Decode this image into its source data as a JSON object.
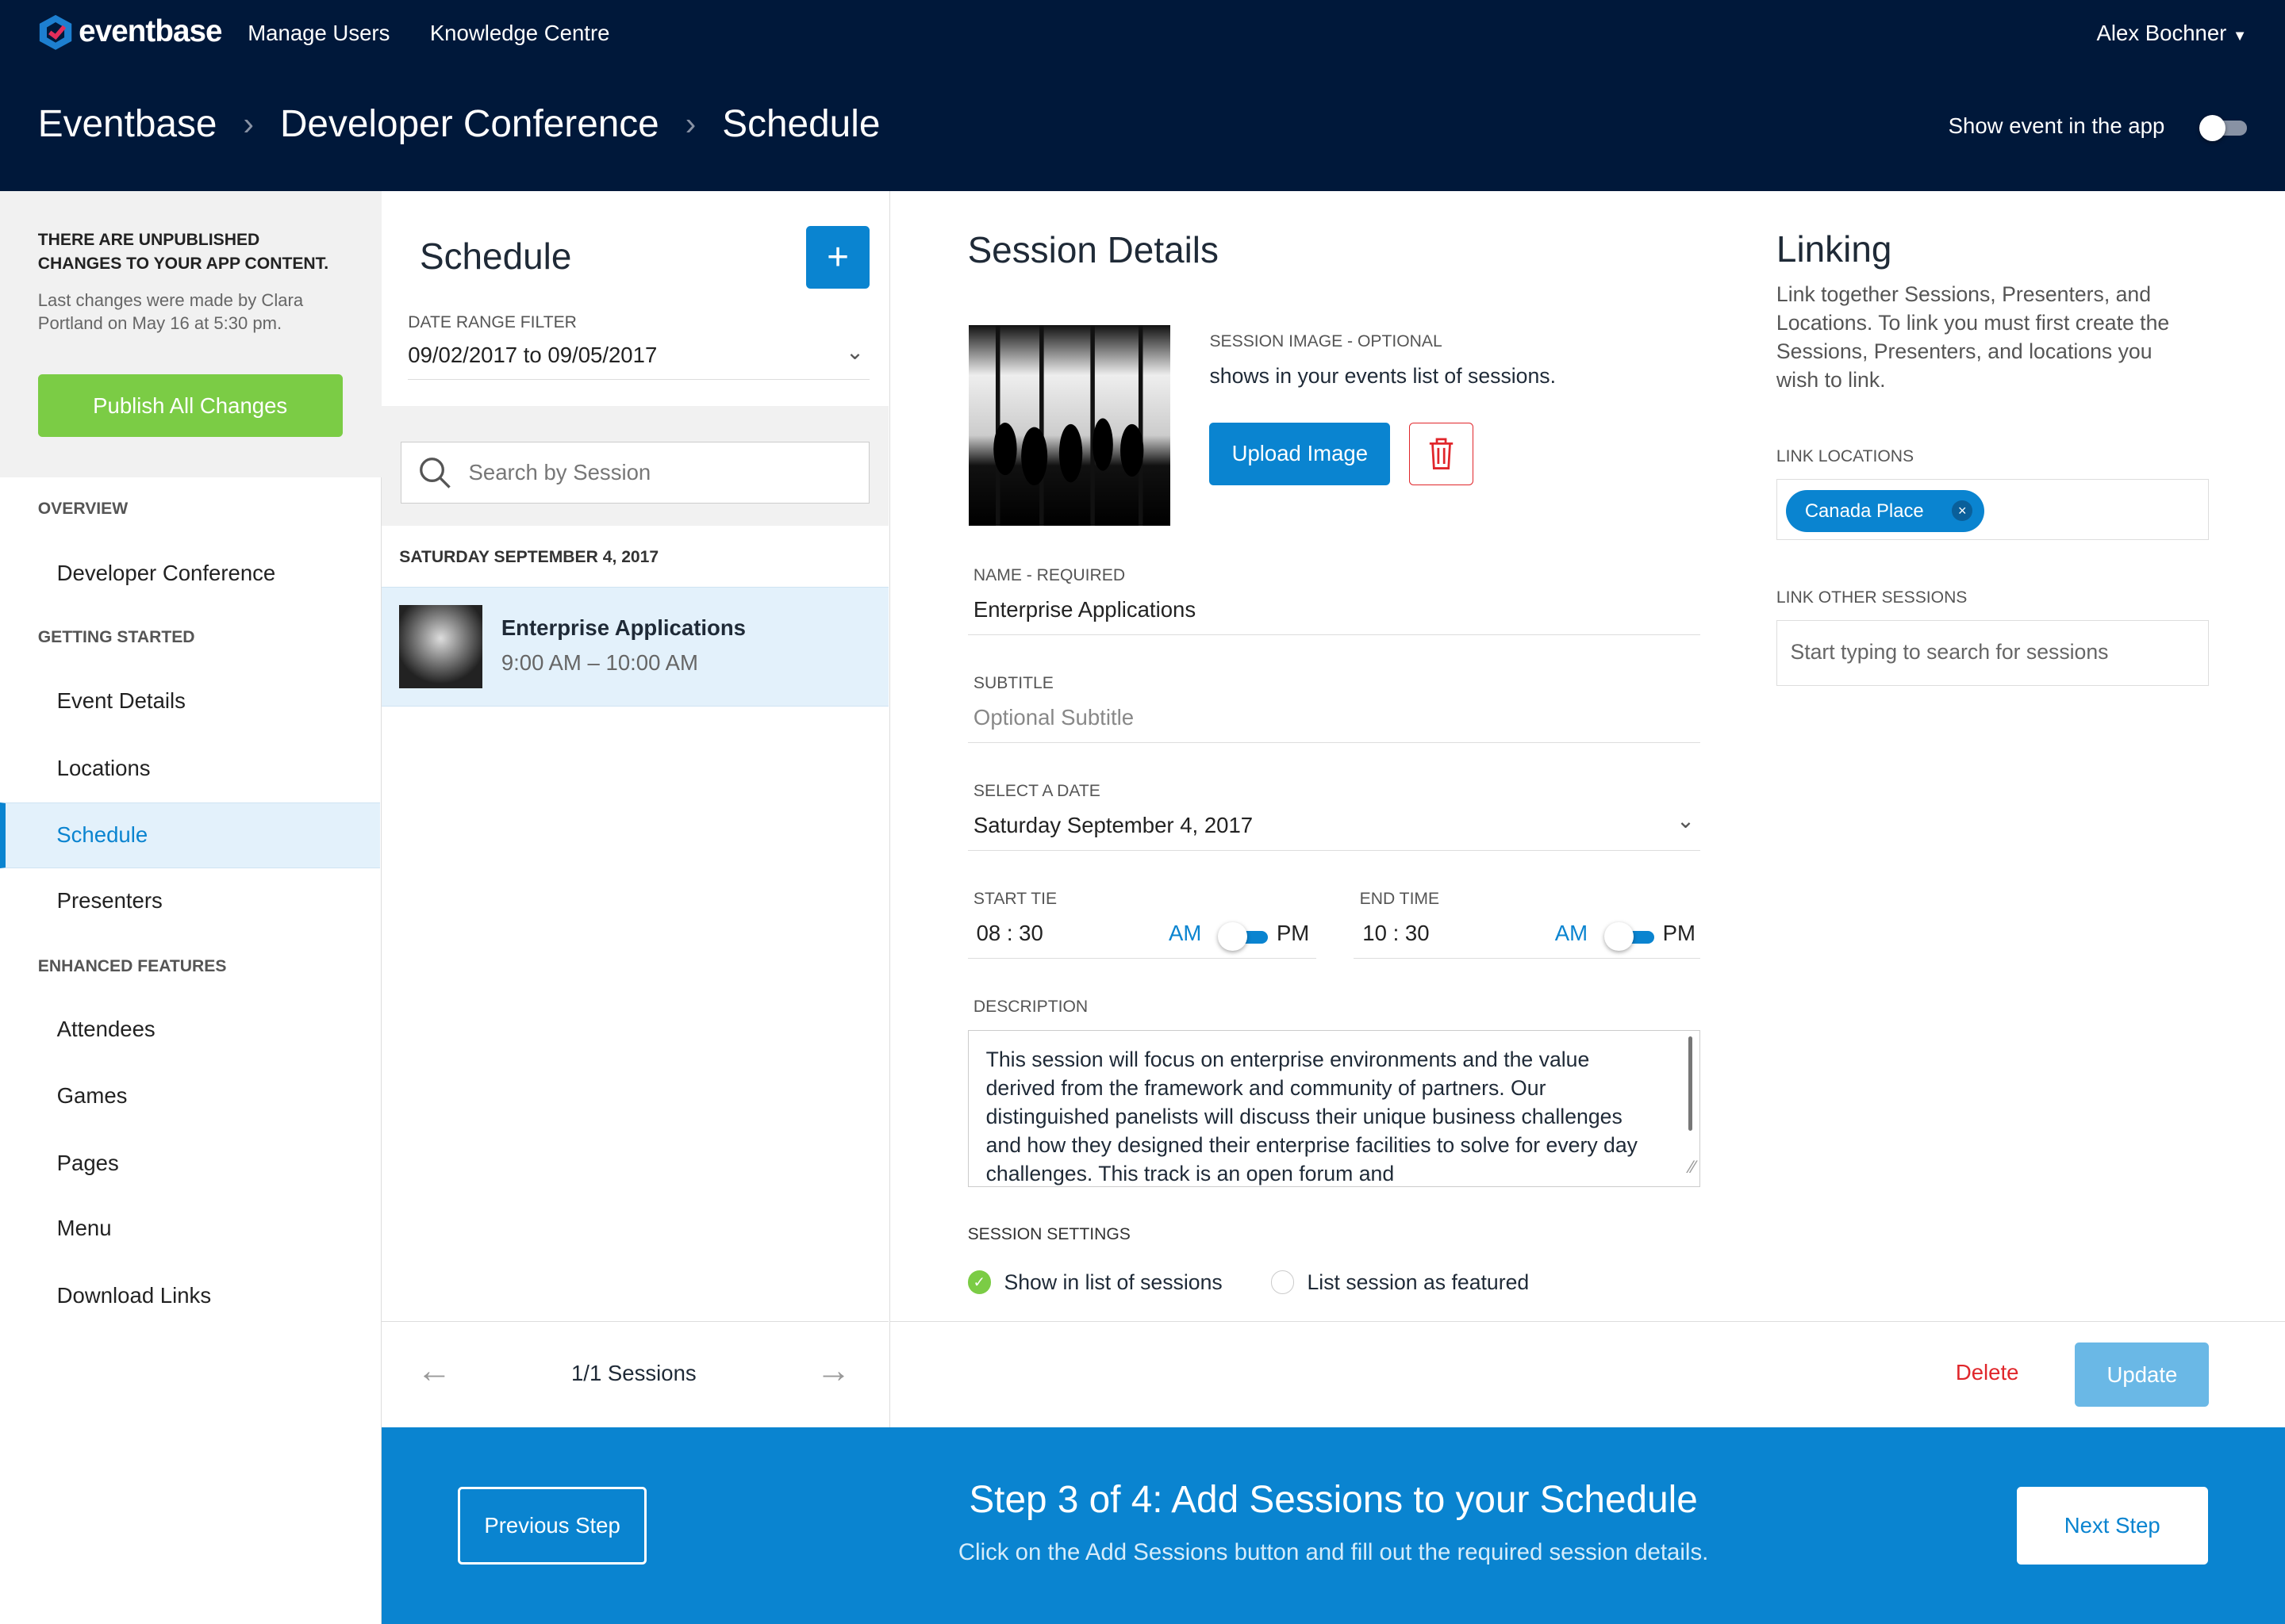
{
  "topbar": {
    "brand": "eventbase",
    "nav": [
      "Manage Users",
      "Knowledge Centre"
    ],
    "user": "Alex Bochner",
    "breadcrumb": [
      "Eventbase",
      "Developer Conference",
      "Schedule"
    ],
    "show_event_label": "Show event in the app",
    "show_event_on": false
  },
  "sidebar": {
    "notice_title": "THERE ARE UNPUBLISHED CHANGES TO YOUR APP CONTENT.",
    "notice_text": "Last changes were made by Clara Portland on May 16 at 5:30 pm.",
    "publish_label": "Publish All Changes",
    "sections": [
      "OVERVIEW",
      "GETTING STARTED",
      "ENHANCED FEATURES"
    ],
    "items": [
      "Developer Conference",
      "Event Details",
      "Locations",
      "Schedule",
      "Presenters",
      "Attendees",
      "Games",
      "Pages",
      "Menu",
      "Download Links"
    ],
    "active": "Schedule"
  },
  "schedule": {
    "title": "Schedule",
    "add_icon": "plus-icon",
    "date_filter_label": "DATE RANGE FILTER",
    "date_filter_value": "09/02/2017 to 09/05/2017",
    "search_placeholder": "Search by Session",
    "day_header": "SATURDAY SEPTEMBER 4, 2017",
    "sessions": [
      {
        "title": "Enterprise Applications",
        "time": "9:00 AM – 10:00 AM"
      }
    ],
    "pager": "1/1 Sessions"
  },
  "details": {
    "title": "Session Details",
    "image_label": "SESSION IMAGE - OPTIONAL",
    "image_hint": "shows in your events list of sessions.",
    "upload_label": "Upload Image",
    "name_label": "NAME - REQUIRED",
    "name_value": "Enterprise Applications",
    "subtitle_label": "SUBTITLE",
    "subtitle_placeholder": "Optional Subtitle",
    "date_label": "SELECT A DATE",
    "date_value": "Saturday September 4, 2017",
    "start_label": "START TIE",
    "start_value": "08 : 30",
    "end_label": "END TIME",
    "end_value": "10 : 30",
    "am": "AM",
    "pm": "PM",
    "description_label": "DESCRIPTION",
    "description": "This session will focus on enterprise environments and the value derived from the framework and community of partners. Our distinguished panelists will discuss their unique business challenges and how they designed their enterprise facilities to solve for every day challenges. This track is an open forum and",
    "settings_label": "SESSION SETTINGS",
    "setting1": "Show in list of sessions",
    "setting1_checked": true,
    "setting2": "List session as featured",
    "setting2_checked": false,
    "delete_label": "Delete",
    "update_label": "Update"
  },
  "linking": {
    "title": "Linking",
    "text": "Link together Sessions, Presenters, and Locations. To link you must first create the Sessions, Presenters, and locations you wish to link.",
    "locations_label": "LINK LOCATIONS",
    "location_tag": "Canada Place",
    "other_label": "LINK OTHER SESSIONS",
    "other_placeholder": "Start typing to search for sessions"
  },
  "footer": {
    "step_title": "Step 3 of 4: Add Sessions to your Schedule",
    "step_text": "Click on the Add Sessions button and fill out the required session details.",
    "prev_label": "Previous Step",
    "next_label": "Next Step"
  },
  "colors": {
    "navy": "#00183a",
    "accent": "#0a84d0",
    "green": "#7bcc45",
    "danger": "#e0262b"
  }
}
